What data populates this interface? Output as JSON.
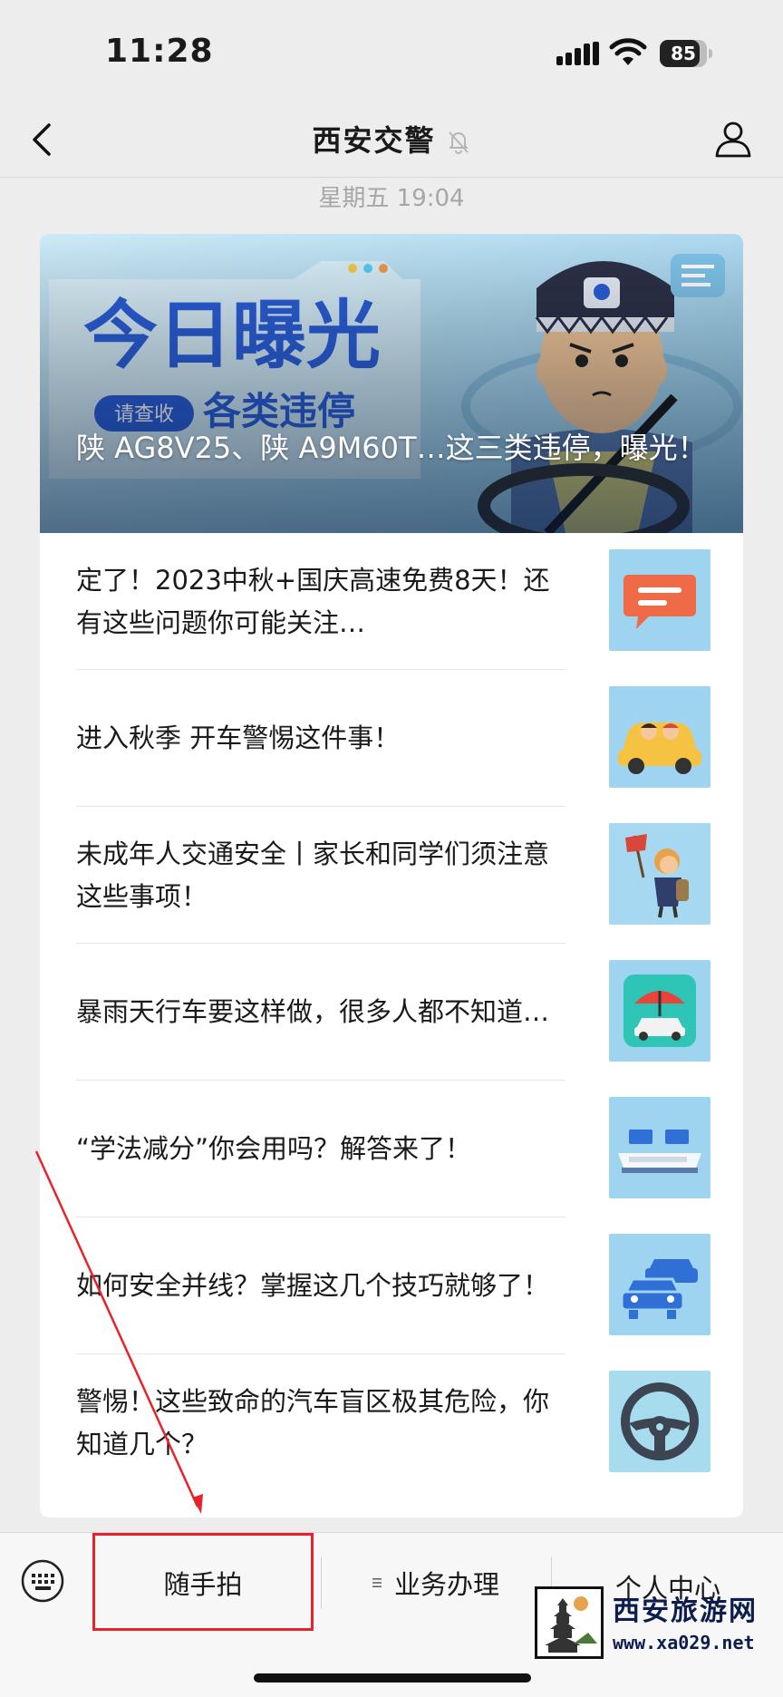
{
  "status_bar": {
    "time": "11:28",
    "battery": "85",
    "battery_level_percent": 85,
    "icons": [
      "cellular-signal-icon",
      "wifi-icon",
      "battery-icon"
    ]
  },
  "nav": {
    "title": "西安交警",
    "icons": [
      "back-icon",
      "mute-bell-icon",
      "profile-icon"
    ]
  },
  "timestamp": "星期五 19:04",
  "cover_article": {
    "title": "陕 AG8V25、陕 A9M60T…这三类违停，曝光！",
    "banner_headline": "今日曝光",
    "banner_badge": "请查收",
    "banner_subline": "各类违停"
  },
  "articles": [
    {
      "title": "定了！2023中秋+国庆高速免费8天！还有这些问题你可能关注…",
      "thumb_icon": "chat-bubble-icon"
    },
    {
      "title": "进入秋季 开车警惕这件事！",
      "thumb_icon": "car-driving-icon"
    },
    {
      "title": "未成年人交通安全丨家长和同学们须注意这些事项！",
      "thumb_icon": "student-flag-icon"
    },
    {
      "title": "暴雨天行车要这样做，很多人都不知道…",
      "thumb_icon": "umbrella-car-icon"
    },
    {
      "title": "“学法减分”你会用吗？解答来了！",
      "thumb_icon": "computer-desk-icon"
    },
    {
      "title": "如何安全并线？掌握这几个技巧就够了！",
      "thumb_icon": "cars-lane-icon"
    },
    {
      "title": "警惕！这些致命的汽车盲区极其危险，你知道几个？",
      "thumb_icon": "steering-wheel-icon"
    }
  ],
  "bottom_menu": {
    "items": [
      {
        "label": "随手拍"
      },
      {
        "label": "业务办理"
      },
      {
        "label": "个人中心"
      }
    ],
    "keyboard_icon": "keyboard-icon"
  },
  "watermark": {
    "title": "西安旅游网",
    "url": "www.xa029.net"
  },
  "colors": {
    "background": "#ededed",
    "annotation_red": "#e8222b",
    "banner_blue": "#2b5fd9"
  }
}
